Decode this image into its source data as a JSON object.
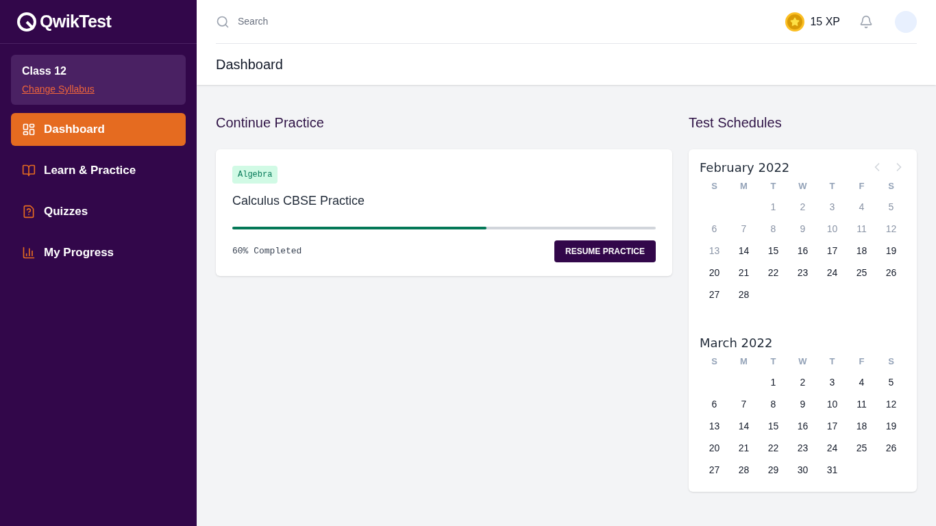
{
  "logo": {
    "text": "QwikTest"
  },
  "syllabus": {
    "class": "Class 12",
    "link": "Change Syllabus"
  },
  "sidebar": {
    "items": [
      {
        "label": "Dashboard",
        "selected": true
      },
      {
        "label": "Learn & Practice",
        "selected": false
      },
      {
        "label": "Quizzes",
        "selected": false
      },
      {
        "label": "My Progress",
        "selected": false
      }
    ]
  },
  "topbar": {
    "search": {
      "placeholder": "Search"
    },
    "xp": "15 XP"
  },
  "page_title": "Dashboard",
  "continue_practice": {
    "heading": "Continue Practice",
    "card": {
      "tag": "Algebra",
      "title": "Calculus CBSE Practice",
      "level": 0.6,
      "progress_text": "60% Completed",
      "button": "RESUME PRACTICE"
    }
  },
  "test_schedules": {
    "heading": "Test Schedules",
    "months": [
      {
        "title": "February 2022",
        "weekdays": [
          "S",
          "M",
          "T",
          "W",
          "T",
          "F",
          "S"
        ],
        "weeks": [
          [
            {
              "kind": "blank"
            },
            {
              "kind": "blank"
            },
            {
              "kind": "day",
              "day": "1",
              "disabled": true
            },
            {
              "kind": "day",
              "day": "2",
              "disabled": true
            },
            {
              "kind": "day",
              "day": "3",
              "disabled": true
            },
            {
              "kind": "day",
              "day": "4",
              "disabled": true
            },
            {
              "kind": "day",
              "day": "5",
              "disabled": true
            }
          ],
          [
            {
              "kind": "day",
              "day": "6",
              "disabled": true
            },
            {
              "kind": "day",
              "day": "7",
              "disabled": true
            },
            {
              "kind": "day",
              "day": "8",
              "disabled": true
            },
            {
              "kind": "day",
              "day": "9",
              "disabled": true
            },
            {
              "kind": "day",
              "day": "10",
              "disabled": true
            },
            {
              "kind": "day",
              "day": "11",
              "disabled": true
            },
            {
              "kind": "day",
              "day": "12",
              "disabled": true
            }
          ],
          [
            {
              "kind": "day",
              "day": "13",
              "disabled": true
            },
            {
              "kind": "day",
              "day": "14",
              "disabled": false
            },
            {
              "kind": "day",
              "day": "15",
              "disabled": false
            },
            {
              "kind": "day",
              "day": "16",
              "disabled": false
            },
            {
              "kind": "day",
              "day": "17",
              "disabled": false
            },
            {
              "kind": "day",
              "day": "18",
              "disabled": false
            },
            {
              "kind": "day",
              "day": "19",
              "disabled": false
            }
          ],
          [
            {
              "kind": "day",
              "day": "20",
              "disabled": false
            },
            {
              "kind": "day",
              "day": "21",
              "disabled": false
            },
            {
              "kind": "day",
              "day": "22",
              "disabled": false
            },
            {
              "kind": "day",
              "day": "23",
              "disabled": false
            },
            {
              "kind": "day",
              "day": "24",
              "disabled": false
            },
            {
              "kind": "day",
              "day": "25",
              "disabled": false
            },
            {
              "kind": "day",
              "day": "26",
              "disabled": false
            }
          ],
          [
            {
              "kind": "day",
              "day": "27",
              "disabled": false
            },
            {
              "kind": "day",
              "day": "28",
              "disabled": false
            }
          ]
        ]
      },
      {
        "title": "March 2022",
        "weekdays": [
          "S",
          "M",
          "T",
          "W",
          "T",
          "F",
          "S"
        ],
        "weeks": [
          [
            {
              "kind": "blank"
            },
            {
              "kind": "blank"
            },
            {
              "kind": "day",
              "day": "1",
              "disabled": false
            },
            {
              "kind": "day",
              "day": "2",
              "disabled": false
            },
            {
              "kind": "day",
              "day": "3",
              "disabled": false
            },
            {
              "kind": "day",
              "day": "4",
              "disabled": false
            },
            {
              "kind": "day",
              "day": "5",
              "disabled": false
            }
          ],
          [
            {
              "kind": "day",
              "day": "6",
              "disabled": false
            },
            {
              "kind": "day",
              "day": "7",
              "disabled": false
            },
            {
              "kind": "day",
              "day": "8",
              "disabled": false
            },
            {
              "kind": "day",
              "day": "9",
              "disabled": false
            },
            {
              "kind": "day",
              "day": "10",
              "disabled": false
            },
            {
              "kind": "day",
              "day": "11",
              "disabled": false
            },
            {
              "kind": "day",
              "day": "12",
              "disabled": false
            }
          ],
          [
            {
              "kind": "day",
              "day": "13",
              "disabled": false
            },
            {
              "kind": "day",
              "day": "14",
              "disabled": false
            },
            {
              "kind": "day",
              "day": "15",
              "disabled": false
            },
            {
              "kind": "day",
              "day": "16",
              "disabled": false
            },
            {
              "kind": "day",
              "day": "17",
              "disabled": false
            },
            {
              "kind": "day",
              "day": "18",
              "disabled": false
            },
            {
              "kind": "day",
              "day": "19",
              "disabled": false
            }
          ],
          [
            {
              "kind": "day",
              "day": "20",
              "disabled": false
            },
            {
              "kind": "day",
              "day": "21",
              "disabled": false
            },
            {
              "kind": "day",
              "day": "22",
              "disabled": false
            },
            {
              "kind": "day",
              "day": "23",
              "disabled": false
            },
            {
              "kind": "day",
              "day": "24",
              "disabled": false
            },
            {
              "kind": "day",
              "day": "25",
              "disabled": false
            },
            {
              "kind": "day",
              "day": "26",
              "disabled": false
            }
          ],
          [
            {
              "kind": "day",
              "day": "27",
              "disabled": false
            },
            {
              "kind": "day",
              "day": "28",
              "disabled": false
            },
            {
              "kind": "day",
              "day": "29",
              "disabled": false
            },
            {
              "kind": "day",
              "day": "30",
              "disabled": false
            },
            {
              "kind": "day",
              "day": "31",
              "disabled": false
            }
          ]
        ]
      }
    ]
  }
}
